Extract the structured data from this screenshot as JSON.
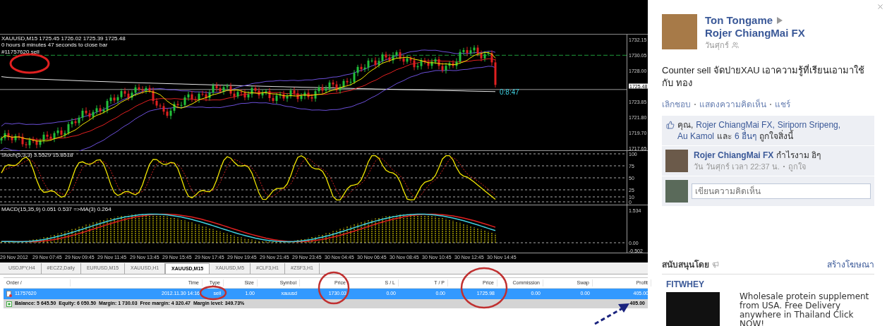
{
  "chart": {
    "header": "XAUUSD,M15 1725.45 1726.02 1725.39 1725.48",
    "bar_timer": "0 hours 8 minutes 47 seconds to close bar",
    "order_label": "#11757620 sell",
    "countdown": "0:8:47",
    "price_axis": [
      {
        "label": "1732.15",
        "kind": "tick"
      },
      {
        "label": "1730.05",
        "kind": "tick"
      },
      {
        "label": "1728.00",
        "kind": "tick"
      },
      {
        "label": "1725.48",
        "kind": "current"
      },
      {
        "label": "1723.85",
        "kind": "tick"
      },
      {
        "label": "1721.80",
        "kind": "tick"
      },
      {
        "label": "1719.70",
        "kind": "tick"
      },
      {
        "label": "1717.65",
        "kind": "tick"
      }
    ],
    "stoch": {
      "header": "Stoch(5,3,3) 3.5529 15.8518",
      "ticks": [
        "100",
        "75",
        "50",
        "25",
        "10",
        "0"
      ]
    },
    "macd": {
      "header": "MACD(15,35,9) 0.051 0.537 =>MA(3) 0.264",
      "ticks": [
        "1.534",
        "0.00",
        "-0.502"
      ]
    },
    "time_axis": [
      "29 Nov 2012",
      "29 Nov 07:45",
      "29 Nov 09:45",
      "29 Nov 11:45",
      "29 Nov 13:45",
      "29 Nov 15:45",
      "29 Nov 17:45",
      "29 Nov 19:45",
      "29 Nov 21:45",
      "29 Nov 23:45",
      "30 Nov 04:45",
      "30 Nov 06:45",
      "30 Nov 08:45",
      "30 Nov 10:45",
      "30 Nov 12:45",
      "30 Nov 14:45"
    ]
  },
  "tabs": [
    {
      "label": "USDJPY,H4",
      "selected": false
    },
    {
      "label": "#ECZ2,Daily",
      "selected": false
    },
    {
      "label": "EURUSD,M15",
      "selected": false
    },
    {
      "label": "XAUUSD,H1",
      "selected": false
    },
    {
      "label": "XAUUSD,M15",
      "selected": true
    },
    {
      "label": "XAUUSD,M5",
      "selected": false
    },
    {
      "label": "#CLF3,H1",
      "selected": false
    },
    {
      "label": "#ZSF3,H1",
      "selected": false
    }
  ],
  "table": {
    "columns": [
      "Order /",
      "Time",
      "Type",
      "Size",
      "Symbol",
      "Price",
      "S / L",
      "T / P",
      "Price",
      "Commission",
      "Swap",
      "Profit"
    ],
    "rows": [
      {
        "cells": [
          "11757620",
          "2012.11.30 14:16",
          "sell",
          "1.00",
          "xauusd",
          "1730.03",
          "0.00",
          "0.00",
          "1725.98",
          "0.00",
          "0.00",
          "405.00"
        ],
        "selected": true
      }
    ],
    "summary": "Balance: 5 645.50  Equity: 6 050.50  Margin: 1 730.03  Free margin: 4 320.47  Margin level: 349.73%",
    "total": "405.00"
  },
  "post": {
    "author": "Ton Tongame",
    "target": "Rojer ChiangMai FX",
    "date": "วันศุกร์",
    "message": "Counter sell จัดปายXAU เอาความรู้ที่เรียนเอามาใช้กับ ทอง",
    "actions": [
      "เลิกชอบ",
      "แสดงความคิดเห็น",
      "แชร์"
    ],
    "likes": [
      {
        "text": "คุณ,",
        "kind": "plain"
      },
      {
        "text": "Rojer ChiangMai FX,",
        "kind": "link"
      },
      {
        "text": "Siriporn Sripeng,",
        "kind": "link"
      },
      {
        "text": "Au Kamol",
        "kind": "link"
      },
      {
        "text": "และ",
        "kind": "plain"
      },
      {
        "text": "6 อื่นๆ",
        "kind": "link"
      },
      {
        "text": "ถูกใจสิ่งนี้",
        "kind": "plain"
      }
    ],
    "comment": {
      "author": "Rojer ChiangMai FX",
      "text": "กำไรงาม อิๆ",
      "meta": "วัน วันศุกร์ เวลา 22:37 น.",
      "like": "ถูกใจ"
    },
    "comment_field": {
      "placeholder": "เขียนความคิดเห็น"
    }
  },
  "sponsored": {
    "heading": "สนับสนุนโดย",
    "create_ad": "สร้างโฆษณา",
    "advertiser": "FITWHEY",
    "text": "Wholesale protein supplement from USA. Free Delivery anywhere in Thailand Click NOW!"
  }
}
